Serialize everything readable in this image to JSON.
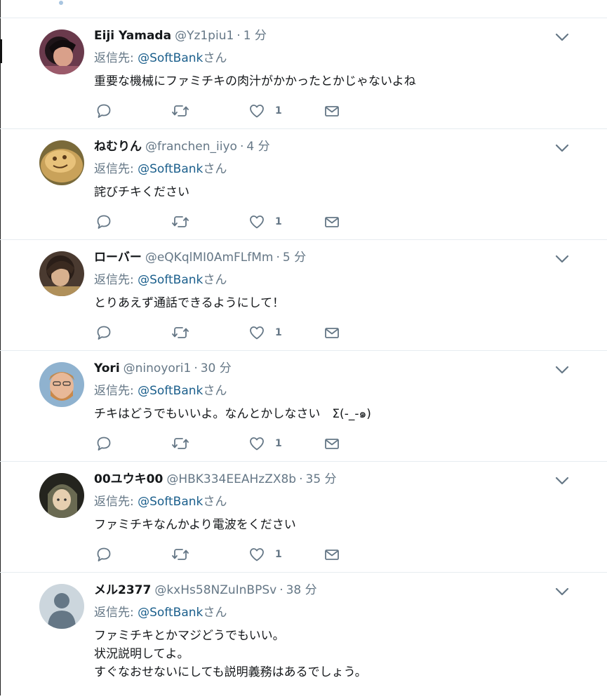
{
  "reply_prefix": "返信先: ",
  "reply_suffix": "さん",
  "tweets": [
    {
      "name": "Eiji Yamada",
      "handle": "@Yz1piu1",
      "time": "1 分",
      "mention": "@SoftBank",
      "lines": [
        "重要な機械にファミチキの肉汁がかかったとかじゃないよね"
      ],
      "likes": "1",
      "avatar_icon": "avatar-photo-icon"
    },
    {
      "name": "ねむりん",
      "handle": "@franchen_iiyo",
      "time": "4 分",
      "mention": "@SoftBank",
      "lines": [
        "詫びチキください"
      ],
      "likes": "1",
      "avatar_icon": "avatar-photo-icon"
    },
    {
      "name": "ローバー",
      "handle": "@eQKqlMI0AmFLfMm",
      "time": "5 分",
      "mention": "@SoftBank",
      "lines": [
        "とりあえず通話できるようにして！"
      ],
      "likes": "1",
      "avatar_icon": "avatar-photo-icon"
    },
    {
      "name": "Yori",
      "handle": "@ninoyori1",
      "time": "30 分",
      "mention": "@SoftBank",
      "lines": [
        "チキはどうでもいいよ。なんとかしなさい　Σ(-_-๑)"
      ],
      "likes": "1",
      "avatar_icon": "avatar-photo-icon"
    },
    {
      "name": "00ユウキ00",
      "handle": "@HBK334EEAHzZX8b",
      "time": "35 分",
      "mention": "@SoftBank",
      "lines": [
        "ファミチキなんかより電波をください"
      ],
      "likes": "1",
      "avatar_icon": "avatar-photo-icon"
    },
    {
      "name": "メル2377",
      "handle": "@kxHs58NZuInBPSv",
      "time": "38 分",
      "mention": "@SoftBank",
      "lines": [
        "ファミチキとかマジどうでもいい。",
        "状況説明してよ。",
        "すぐなおせないにしても説明義務はあるでしょう。"
      ],
      "likes": "",
      "avatar_icon": "default-avatar-icon"
    }
  ],
  "colors": {
    "text": "#14171a",
    "secondary": "#657786",
    "link": "#1b5f8c",
    "icon": "#657786",
    "separator": "#e6ecf0"
  }
}
